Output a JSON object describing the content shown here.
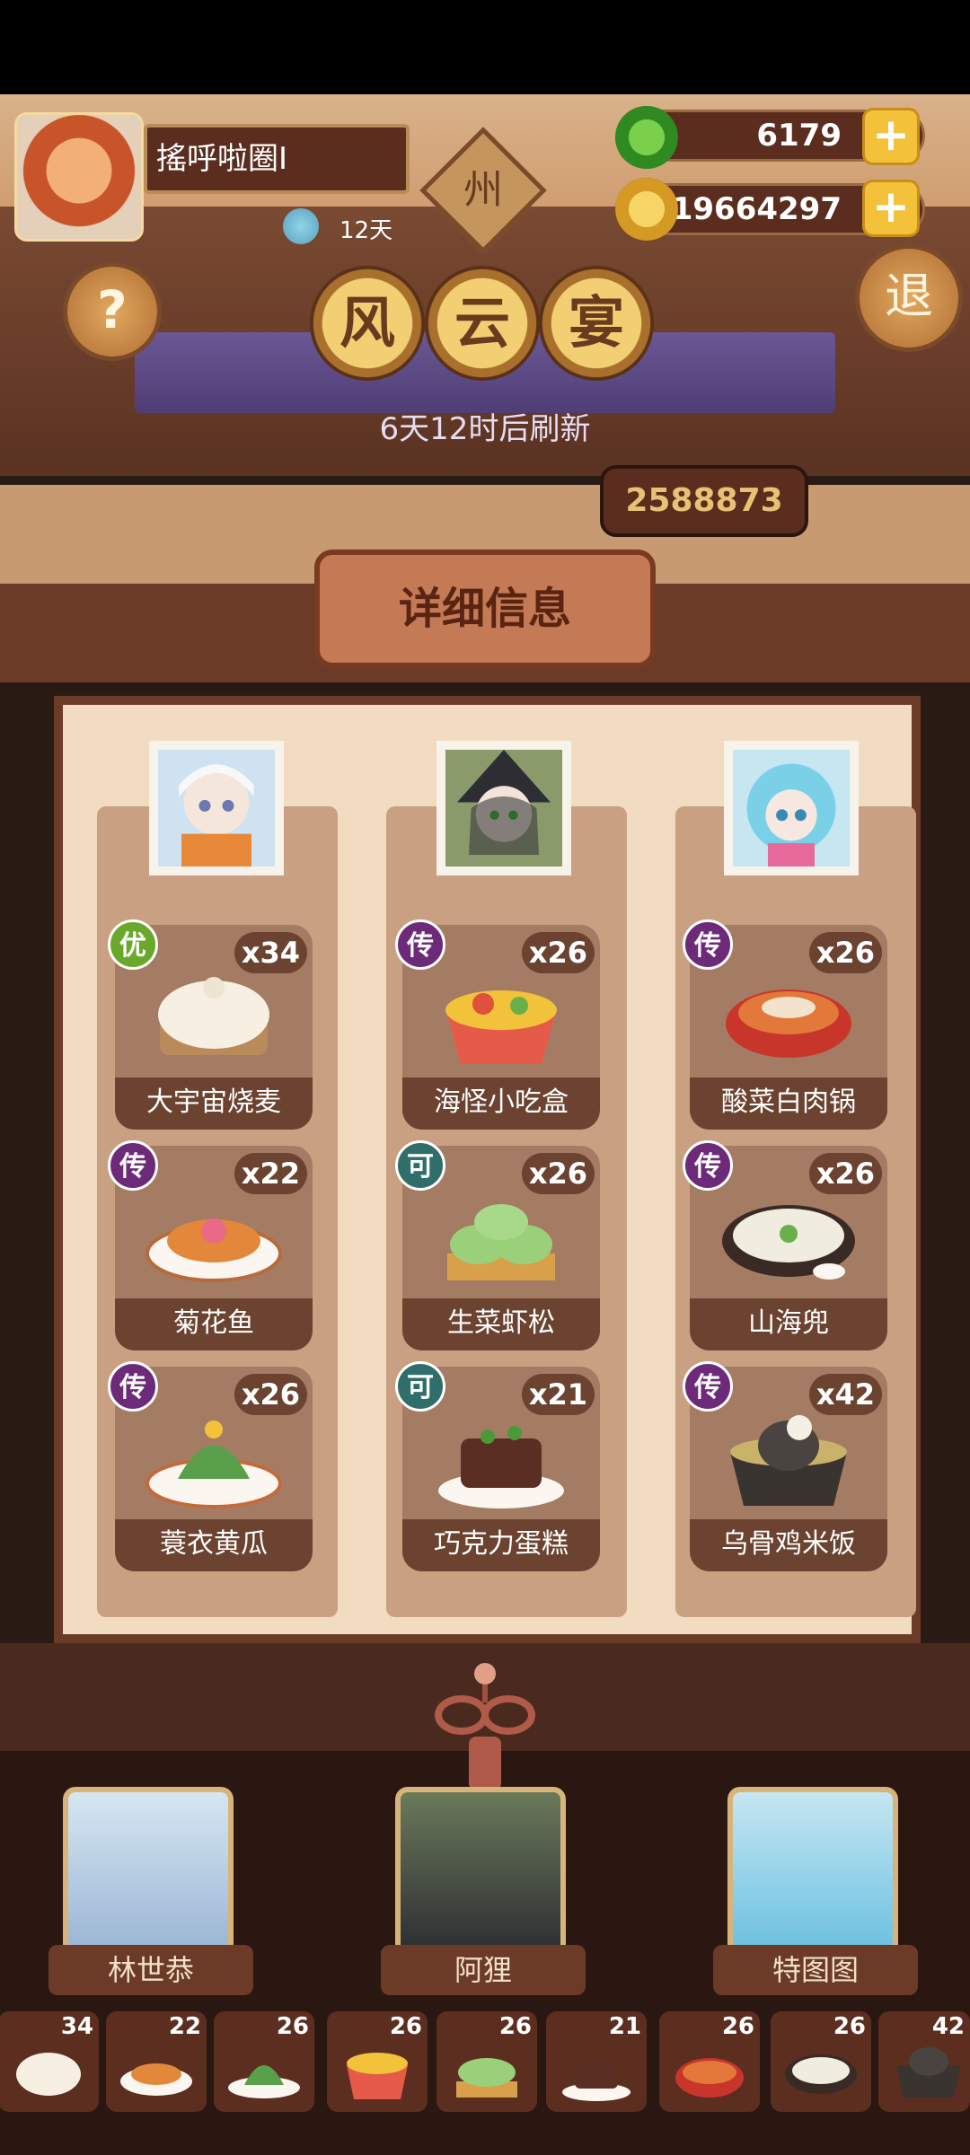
{
  "player": {
    "name": "搖呼啦圈I",
    "days_label": "12天",
    "region_char": "州"
  },
  "resources": {
    "jade": "6179",
    "coins": "19664297"
  },
  "header": {
    "title_chars": [
      "风",
      "云",
      "宴"
    ],
    "refresh_text": "6天12时后刷新",
    "score": "2588873",
    "help_label": "?",
    "exit_label": "退"
  },
  "detail_title": "详细信息",
  "columns": [
    {
      "chef": "林世恭",
      "dishes": [
        {
          "name": "大宇宙烧麦",
          "count": "x34",
          "rank": "优"
        },
        {
          "name": "菊花鱼",
          "count": "x22",
          "rank": "传"
        },
        {
          "name": "蓑衣黄瓜",
          "count": "x26",
          "rank": "传"
        }
      ]
    },
    {
      "chef": "阿狸",
      "dishes": [
        {
          "name": "海怪小吃盒",
          "count": "x26",
          "rank": "传"
        },
        {
          "name": "生菜虾松",
          "count": "x26",
          "rank": "可"
        },
        {
          "name": "巧克力蛋糕",
          "count": "x21",
          "rank": "可"
        }
      ]
    },
    {
      "chef": "特图图",
      "dishes": [
        {
          "name": "酸菜白肉锅",
          "count": "x26",
          "rank": "传"
        },
        {
          "name": "山海兜",
          "count": "x26",
          "rank": "传"
        },
        {
          "name": "乌骨鸡米饭",
          "count": "x42",
          "rank": "传"
        }
      ]
    }
  ],
  "strip": [
    "34",
    "22",
    "26",
    "26",
    "26",
    "21",
    "26",
    "26",
    "42"
  ]
}
